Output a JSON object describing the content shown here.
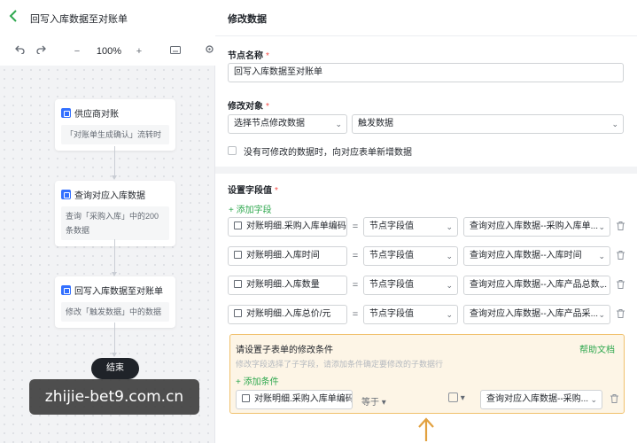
{
  "flow": {
    "back_icon": "chevron-left-icon",
    "title": "回写入库数据至对账单",
    "toolbar": {
      "undo_icon": "undo-icon",
      "redo_icon": "redo-icon",
      "zoom_out": "−",
      "zoom_level": "100%",
      "zoom_in": "+",
      "keyboard_icon": "keyboard-icon",
      "settings_icon": "gear-icon"
    },
    "nodes": [
      {
        "title": "供应商对账",
        "desc": "「对账单生成确认」流转时"
      },
      {
        "title": "查询对应入库数据",
        "desc": "查询「采购入库」中的200条数据"
      },
      {
        "title": "回写入库数据至对账单",
        "desc": "修改「触发数据」中的数据"
      }
    ],
    "end_label": "结束"
  },
  "watermark": "zhijie-bet9.com.cn",
  "panel": {
    "title": "修改数据",
    "node_name_label": "节点名称",
    "node_name_value": "回写入库数据至对账单",
    "target_label": "修改对象",
    "target_select_1": "选择节点修改数据",
    "target_select_2": "触发数据",
    "checkbox_label": "没有可修改的数据时，向对应表单新增数据",
    "fields_label": "设置字段值",
    "add_field": "添加字段",
    "required_mark": "*",
    "field_rows": [
      {
        "name": "对账明细.采购入库单编码",
        "op": "=",
        "type": "节点字段值",
        "value": "查询对应入库数据--采购入库单..."
      },
      {
        "name": "对账明细.入库时间",
        "op": "=",
        "type": "节点字段值",
        "value": "查询对应入库数据--入库时间"
      },
      {
        "name": "对账明细.入库数量",
        "op": "=",
        "type": "节点字段值",
        "value": "查询对应入库数据--入库产品总数..."
      },
      {
        "name": "对账明细.入库总价/元",
        "op": "=",
        "type": "节点字段值",
        "value": "查询对应入库数据--入库产品采..."
      }
    ],
    "condition": {
      "title": "请设置子表单的修改条件",
      "help": "帮助文档",
      "desc": "修改字段选择了子字段，请添加条件确定要修改的子数据行",
      "add": "添加条件",
      "field": "对账明细.采购入库单编码",
      "op": "等于",
      "value": "查询对应入库数据--采购..."
    }
  },
  "colors": {
    "accent": "#2fa84f",
    "node_icon": "#3370ff",
    "condition_border": "#f0c06b",
    "condition_bg": "#fdf5e6",
    "end_node": "#1f2329"
  }
}
